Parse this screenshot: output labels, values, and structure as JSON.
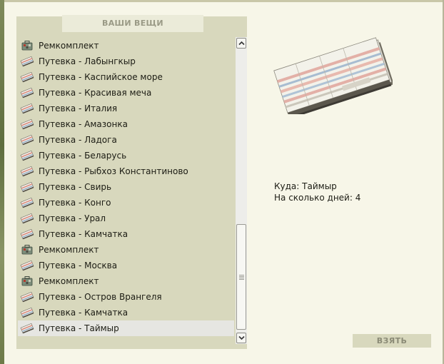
{
  "panel": {
    "title": "ВАШИ ВЕЩИ"
  },
  "items": [
    {
      "label": "Ремкомплект",
      "icon": "repair-kit-icon"
    },
    {
      "label": "Путевка - Лабынгкыр",
      "icon": "ticket-icon"
    },
    {
      "label": "Путевка - Каспийское море",
      "icon": "ticket-icon"
    },
    {
      "label": "Путевка - Красивая меча",
      "icon": "ticket-icon"
    },
    {
      "label": "Путевка - Италия",
      "icon": "ticket-icon"
    },
    {
      "label": "Путевка - Амазонка",
      "icon": "ticket-icon"
    },
    {
      "label": "Путевка - Ладога",
      "icon": "ticket-icon"
    },
    {
      "label": "Путевка - Беларусь",
      "icon": "ticket-icon"
    },
    {
      "label": "Путевка - Рыбхоз Константиново",
      "icon": "ticket-icon"
    },
    {
      "label": "Путевка - Свирь",
      "icon": "ticket-icon"
    },
    {
      "label": "Путевка - Конго",
      "icon": "ticket-icon"
    },
    {
      "label": "Путевка - Урал",
      "icon": "ticket-icon"
    },
    {
      "label": "Путевка - Камчатка",
      "icon": "ticket-icon"
    },
    {
      "label": "Ремкомплект",
      "icon": "repair-kit-icon"
    },
    {
      "label": "Путевка - Москва",
      "icon": "ticket-icon"
    },
    {
      "label": "Ремкомплект",
      "icon": "repair-kit-icon"
    },
    {
      "label": "Путевка - Остров Врангеля",
      "icon": "ticket-icon"
    },
    {
      "label": "Путевка - Камчатка",
      "icon": "ticket-icon"
    },
    {
      "label": "Путевка - Таймыр",
      "icon": "ticket-icon",
      "selected": true
    }
  ],
  "detail": {
    "destination_label": "Куда:",
    "destination_value": "Таймыр",
    "days_label": "На сколько дней:",
    "days_value": "4"
  },
  "actions": {
    "take_label": "ВЗЯТЬ"
  },
  "colors": {
    "background": "#f7f6e8",
    "panel": "#d8d8bd",
    "header": "#ebebd9",
    "selected_row": "#e6e6e2",
    "button_text": "#8b8b76"
  }
}
